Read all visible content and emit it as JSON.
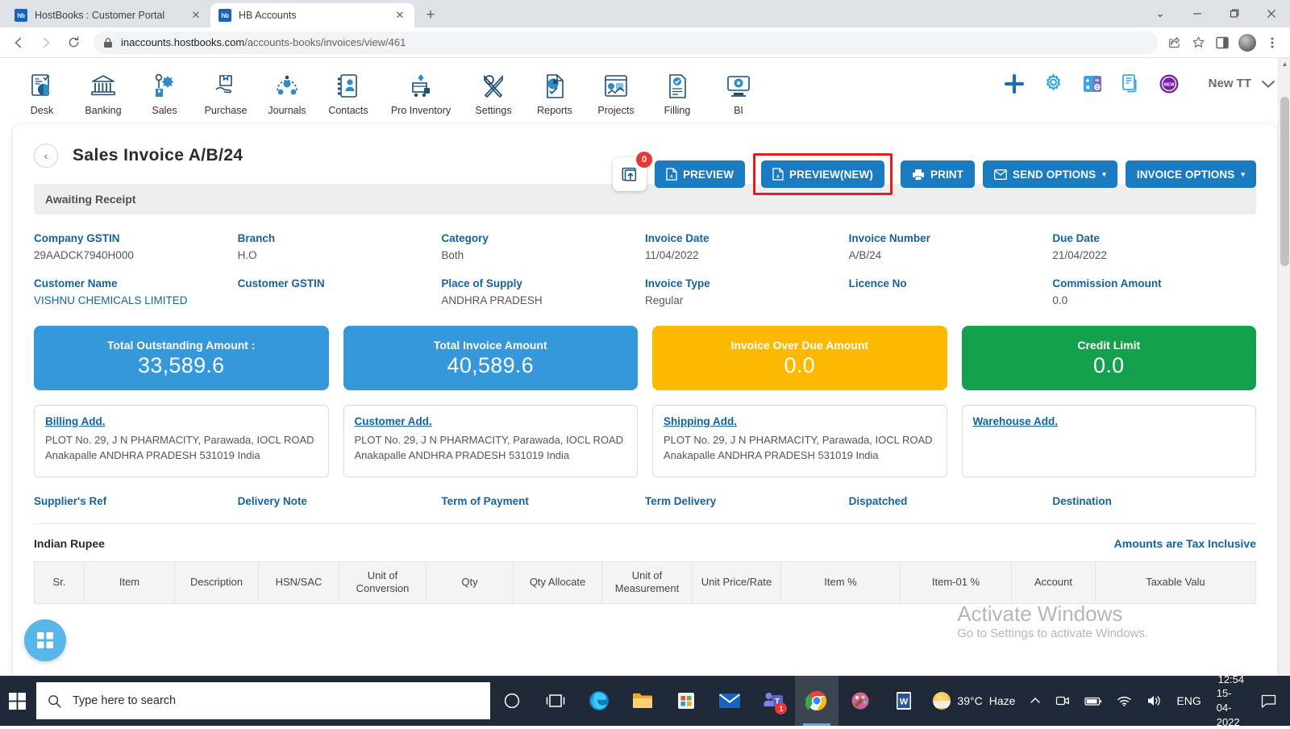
{
  "browser": {
    "tabs": [
      {
        "title": "HostBooks : Customer Portal",
        "favicon_text": "hb",
        "active": false
      },
      {
        "title": "HB Accounts",
        "favicon_text": "hb",
        "active": true
      }
    ],
    "new_tab_label": "+",
    "window_controls": {
      "minimize": "—",
      "maximize": "❐",
      "close": "✕",
      "chevron": "⌄"
    },
    "url_host": "inaccounts.hostbooks.com",
    "url_path": "/accounts-books/invoices/view/461",
    "back_label": "←",
    "forward_label": "→",
    "reload_label": "⟳"
  },
  "app_nav": {
    "items": [
      {
        "label": "Desk",
        "icon": "desk-icon"
      },
      {
        "label": "Banking",
        "icon": "bank-icon"
      },
      {
        "label": "Sales",
        "icon": "sales-icon"
      },
      {
        "label": "Purchase",
        "icon": "purchase-icon"
      },
      {
        "label": "Journals",
        "icon": "journals-icon"
      },
      {
        "label": "Contacts",
        "icon": "contacts-icon"
      },
      {
        "label": "Pro Inventory",
        "icon": "inventory-icon"
      },
      {
        "label": "Settings",
        "icon": "settings-tools-icon"
      },
      {
        "label": "Reports",
        "icon": "reports-icon"
      },
      {
        "label": "Projects",
        "icon": "projects-icon"
      },
      {
        "label": "Filling",
        "icon": "filling-icon"
      },
      {
        "label": "BI",
        "icon": "bi-icon"
      }
    ],
    "right_icons": [
      "plus-icon",
      "gear-icon",
      "calculator-icon",
      "document-icon",
      "new-badge-icon"
    ],
    "user_name": "New TT",
    "user_caret": "⌄"
  },
  "invoice": {
    "page_title": "Sales Invoice A/B/24",
    "back_arrow": "‹",
    "attachment_badge": "0",
    "actions": {
      "preview": "PREVIEW",
      "preview_new": "PREVIEW(NEW)",
      "print": "PRINT",
      "send_options": "SEND OPTIONS",
      "invoice_options": "INVOICE OPTIONS",
      "caret": "▾"
    },
    "status": "Awaiting Receipt",
    "fields": [
      {
        "label": "Company GSTIN",
        "value": "29AADCK7940H000",
        "link": false
      },
      {
        "label": "Branch",
        "value": "H.O",
        "link": false
      },
      {
        "label": "Category",
        "value": "Both",
        "link": false
      },
      {
        "label": "Invoice Date",
        "value": "11/04/2022",
        "link": false
      },
      {
        "label": "Invoice Number",
        "value": "A/B/24",
        "link": false
      },
      {
        "label": "Due Date",
        "value": "21/04/2022",
        "link": false
      },
      {
        "label": "Customer Name",
        "value": "VISHNU CHEMICALS LIMITED",
        "link": true
      },
      {
        "label": "Customer GSTIN",
        "value": "",
        "link": false
      },
      {
        "label": "Place of Supply",
        "value": "ANDHRA PRADESH",
        "link": false
      },
      {
        "label": "Invoice Type",
        "value": "Regular",
        "link": false
      },
      {
        "label": "Licence No",
        "value": "",
        "link": false
      },
      {
        "label": "Commission Amount",
        "value": "0.0",
        "link": false
      }
    ],
    "stats": [
      {
        "label": "Total Outstanding Amount :",
        "value": "33,589.6",
        "color": "#3498db"
      },
      {
        "label": "Total Invoice Amount",
        "value": "40,589.6",
        "color": "#3498db"
      },
      {
        "label": "Invoice Over Due Amount",
        "value": "0.0",
        "color": "#fcb900"
      },
      {
        "label": "Credit Limit",
        "value": "0.0",
        "color": "#13a14d"
      }
    ],
    "addresses": [
      {
        "title": "Billing Add.",
        "text": "PLOT No. 29, J N PHARMACITY, Parawada, IOCL ROAD Anakapalle ANDHRA PRADESH 531019 India"
      },
      {
        "title": "Customer Add.",
        "text": "PLOT No. 29, J N PHARMACITY, Parawada, IOCL ROAD Anakapalle ANDHRA PRADESH 531019 India"
      },
      {
        "title": "Shipping Add.",
        "text": "PLOT No. 29, J N PHARMACITY, Parawada, IOCL ROAD Anakapalle ANDHRA PRADESH 531019 India"
      },
      {
        "title": "Warehouse Add.",
        "text": ""
      }
    ],
    "meta_fields": [
      {
        "label": "Supplier's Ref",
        "value": ""
      },
      {
        "label": "Delivery Note",
        "value": ""
      },
      {
        "label": "Term of Payment",
        "value": ""
      },
      {
        "label": "Term Delivery",
        "value": ""
      },
      {
        "label": "Dispatched",
        "value": ""
      },
      {
        "label": "Destination",
        "value": ""
      }
    ],
    "currency": "Indian Rupee",
    "tax_note": "Amounts are Tax Inclusive",
    "table_headers": [
      "Sr.",
      "Item",
      "Description",
      "HSN/SAC",
      "Unit of Conversion",
      "Qty",
      "Qty Allocate",
      "Unit of Measurement",
      "Unit Price/Rate",
      "Item %",
      "Item-01 %",
      "Account",
      "Taxable Valu"
    ]
  },
  "watermark": {
    "line1": "Activate Windows",
    "line2": "Go to Settings to activate Windows."
  },
  "taskbar": {
    "search_placeholder": "Type here to search",
    "temperature": "39°C",
    "weather": "Haze",
    "language": "ENG",
    "time": "12:54",
    "date": "15-04-2022",
    "teams_badge": "1",
    "apps": [
      "cortana-icon",
      "task-view-icon",
      "edge-icon",
      "file-explorer-icon",
      "store-icon",
      "mail-icon",
      "teams-icon",
      "chrome-icon",
      "paint-icon",
      "word-icon"
    ]
  }
}
